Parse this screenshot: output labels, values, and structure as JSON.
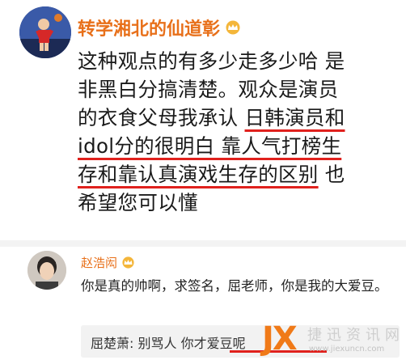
{
  "post": {
    "author": "转学湘北的仙道彰",
    "badge_icon": "vip-crown-icon",
    "lines": [
      "这种观点的有多少走多少哈 是",
      "非黑白分搞清楚。观众是演员",
      "的衣食父母我承认 ",
      "日韩演员和",
      "idol分的很明白 靠人气打榜生",
      "存和靠认真演戏生存的区别",
      " 也",
      "希望您可以懂"
    ]
  },
  "comment": {
    "author": "赵浩闳",
    "badge_icon": "vip-crown-icon",
    "text": "你是真的帅啊，求签名，屈老师，你是我的大爱豆。",
    "reply": {
      "author": "屈楚萧:",
      "text": " 别骂人 你才爱豆呢 "
    }
  },
  "watermark": {
    "logo": "JX",
    "text": "捷迅资讯网",
    "url": "www.jiexuncn.com"
  },
  "colors": {
    "name_orange": "#e8701a",
    "underline_red": "#e0211d",
    "watermark_orange": "#f07a18"
  }
}
